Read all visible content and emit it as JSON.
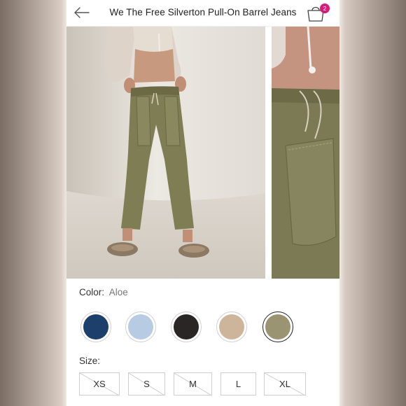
{
  "header": {
    "title": "We The Free Silverton Pull-On Barrel Jeans",
    "bag_count": "2"
  },
  "color": {
    "label": "Color:",
    "selected": "Aloe",
    "swatches": [
      {
        "name": "indigo",
        "color": "#1d3f6c"
      },
      {
        "name": "light-blue",
        "color": "#b7cbe2"
      },
      {
        "name": "black",
        "color": "#2a2626"
      },
      {
        "name": "tan",
        "color": "#cdb59b"
      },
      {
        "name": "aloe",
        "color": "#9a9472"
      }
    ]
  },
  "size": {
    "label": "Size:",
    "options": [
      "XS",
      "S",
      "M",
      "L",
      "XL"
    ]
  }
}
